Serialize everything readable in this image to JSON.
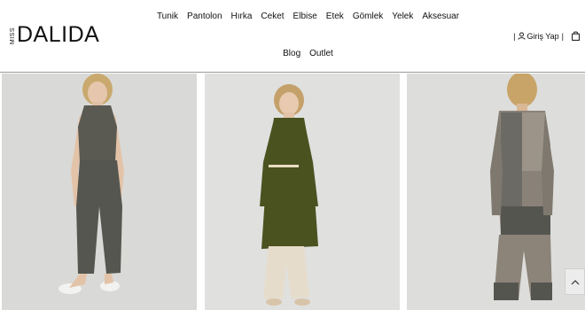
{
  "brand": {
    "prefix": "MISS",
    "name": "DALIDA"
  },
  "nav": {
    "row1": [
      "Tunik",
      "Pantolon",
      "Hırka",
      "Ceket",
      "Elbise",
      "Etek",
      "Gömlek",
      "Yelek",
      "Aksesuar"
    ],
    "row2": [
      "Blog",
      "Outlet"
    ]
  },
  "header_right": {
    "sep": "|",
    "login_label": "Giriş Yap"
  },
  "icons": {
    "login": "user-icon",
    "cart": "shopping-bag-icon",
    "scroll_top": "chevron-up-icon"
  },
  "colors": {
    "header_border": "#9a9a9a",
    "photo_background": "#dadad8",
    "scroll_button": "#ececec"
  },
  "products": [
    {
      "name": "product-1",
      "outfit": "grey knit sleeveless top with grey trousers"
    },
    {
      "name": "product-2",
      "outfit": "olive green shirt dress with cream wide trousers"
    },
    {
      "name": "product-3",
      "outfit": "color-block knit long cardigan, back view"
    }
  ]
}
